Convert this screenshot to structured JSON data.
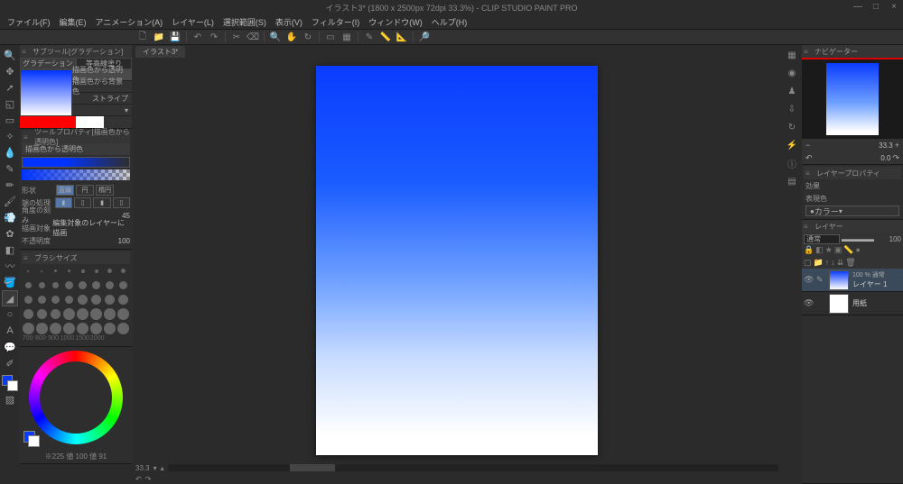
{
  "app": {
    "title": "イラスト3* (1800 x 2500px 72dpi 33.3%) - CLIP STUDIO PAINT PRO"
  },
  "menu": [
    "ファイル(F)",
    "編集(E)",
    "アニメーション(A)",
    "レイヤー(L)",
    "選択範囲(S)",
    "表示(V)",
    "フィルター(I)",
    "ウィンドウ(W)",
    "ヘルプ(H)"
  ],
  "canvas": {
    "tab": "イラスト3*",
    "zoom": "33.3"
  },
  "subtool": {
    "header": "サブツール[グラデーション]",
    "tabs": [
      "グラデーション",
      "等高線塗り"
    ],
    "items": [
      "描画色から透明色",
      "描画色から背景色",
      "ストライプ"
    ]
  },
  "toolprop": {
    "header": "ツールプロパティ[描画色から透明色]",
    "name": "描画色から透明色",
    "shape_label": "形状",
    "shapes": [
      "直線",
      "円",
      "楕円"
    ],
    "edge_label": "端の処理",
    "angle_label": "角度の刻み",
    "angle_val": "45",
    "target_label": "描画対象",
    "target_val": "編集対象のレイヤーに描画",
    "opacity_label": "不透明度",
    "opacity_val": "100"
  },
  "brushsize": {
    "header": "ブラシサイズ",
    "labels": [
      "700",
      "800",
      "900",
      "1000",
      "1500",
      "2000"
    ]
  },
  "color": {
    "rgb": "※225 値 100 値 91"
  },
  "nav": {
    "header": "ナビゲーター",
    "zoom": "33.3",
    "angle": "0.0"
  },
  "layerprop": {
    "header": "レイヤープロパティ",
    "effect": "効果",
    "expr_label": "表現色",
    "expr_val": "カラー"
  },
  "layers": {
    "header": "レイヤー",
    "blend": "通常",
    "opacity": "100",
    "items": [
      {
        "meta": "100 % 通常",
        "name": "レイヤー 1"
      },
      {
        "meta": "",
        "name": "用紙"
      }
    ]
  }
}
